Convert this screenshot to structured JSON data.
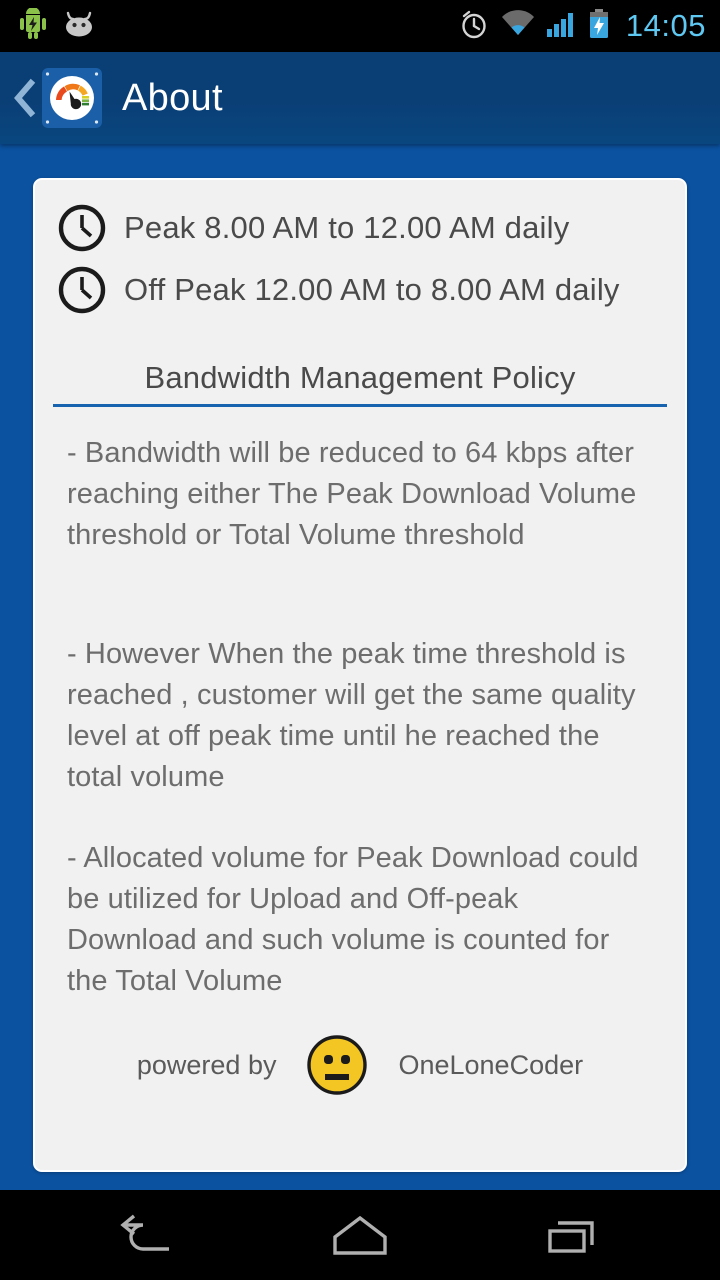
{
  "status_bar": {
    "notifications": [
      {
        "name": "android-charging-icon",
        "label": "Android charging"
      },
      {
        "name": "blob-face-icon",
        "label": "Notification"
      }
    ],
    "icons": [
      {
        "name": "alarm-icon",
        "label": "Alarm set"
      },
      {
        "name": "wifi-icon",
        "label": "Wi-Fi"
      },
      {
        "name": "cellular-signal-icon",
        "label": "Signal"
      },
      {
        "name": "battery-charging-icon",
        "label": "Battery charging"
      }
    ],
    "time": "14:05",
    "time_color": "#5ec8f2"
  },
  "action_bar": {
    "back_label": "Back",
    "app_icon_name": "speedometer-app-icon",
    "title": "About",
    "background_color": "#0a3f76"
  },
  "theme": {
    "page_background": "#0b52a0",
    "card_background": "#f1f1f1",
    "accent_rule": "#1763b0",
    "body_text": "#6d6d6d",
    "emoji_yellow": "#f3c623"
  },
  "card": {
    "schedule": [
      {
        "icon": "clock-icon",
        "text": "Peak 8.00 AM to 12.00 AM daily"
      },
      {
        "icon": "clock-icon",
        "text": "Off Peak 12.00 AM to 8.00 AM daily"
      }
    ],
    "section_title": "Bandwidth Management Policy",
    "paragraphs": [
      "- Bandwidth will be reduced to 64 kbps after reaching either The Peak Download Volume threshold or Total Volume threshold",
      "- However When the peak time threshold is reached , customer will get the same quality level at off peak time until he reached the total volume",
      "- Allocated volume for Peak Download could be utilized for Upload and Off-peak Download and such volume is counted for the Total Volume"
    ],
    "footer": {
      "prefix": "powered by",
      "emoji_name": "neutral-face-emoji",
      "brand": "OneLoneCoder"
    }
  },
  "nav_bar": {
    "buttons": [
      {
        "name": "nav-back-button",
        "label": "Back"
      },
      {
        "name": "nav-home-button",
        "label": "Home"
      },
      {
        "name": "nav-recents-button",
        "label": "Recent apps"
      }
    ]
  }
}
